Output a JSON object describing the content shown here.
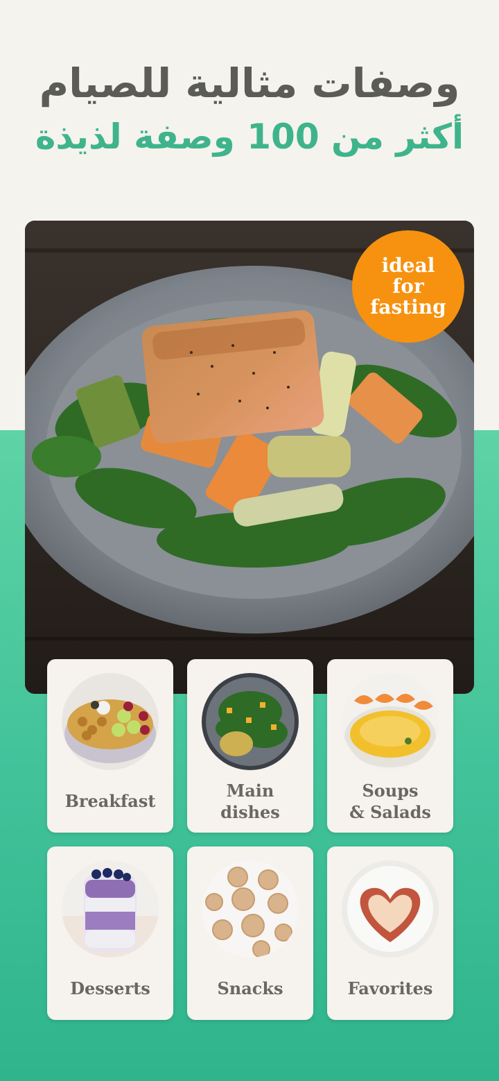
{
  "headline": {
    "line1": "وصفات مثالية للصيام",
    "line2": "أكثر من 100 وصفة لذيذة"
  },
  "hero": {
    "image": "salmon-salad-plate",
    "badge": {
      "line1": "ideal",
      "line2": "for",
      "line3": "fasting",
      "color": "#f6920f"
    }
  },
  "categories": [
    {
      "line1": "Breakfast",
      "line2": "",
      "image": "granola-bowl"
    },
    {
      "line1": "Main",
      "line2": "dishes",
      "image": "spinach-plate"
    },
    {
      "line1": "Soups",
      "line2": "& Salads",
      "image": "shrimp-soup"
    },
    {
      "line1": "Desserts",
      "line2": "",
      "image": "chia-pudding"
    },
    {
      "line1": "Snacks",
      "line2": "",
      "image": "energy-balls"
    },
    {
      "line1": "Favorites",
      "line2": "",
      "image": "heart-pancake"
    }
  ],
  "colors": {
    "accent": "#3fb48c",
    "title": "#5b5b57",
    "card": "#f6f3ee"
  }
}
